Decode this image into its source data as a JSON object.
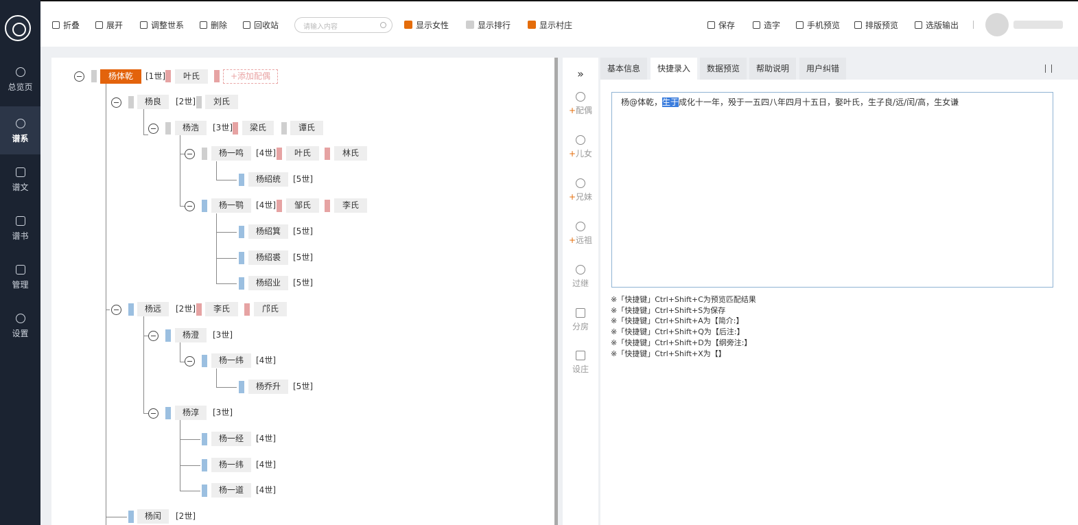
{
  "sidebar": {
    "items": [
      {
        "label": "总览页",
        "icon": "pie-chart-icon"
      },
      {
        "label": "谱系",
        "icon": "family-tree-icon"
      },
      {
        "label": "谱文",
        "icon": "document-icon"
      },
      {
        "label": "谱书",
        "icon": "book-icon"
      },
      {
        "label": "管理",
        "icon": "grid-icon"
      },
      {
        "label": "设置",
        "icon": "gear-icon"
      }
    ],
    "active": "谱系"
  },
  "toolbar": {
    "collapse": "折叠",
    "expand": "展开",
    "adjust": "调整世系",
    "delete": "删除",
    "recycle": "回收站",
    "search_placeholder": "请输入内容",
    "show_female": "显示女性",
    "show_rank": "显示排行",
    "show_village": "显示村庄",
    "save": "保存",
    "make_char": "造字",
    "mobile_preview": "手机预览",
    "layout_preview": "排版预览",
    "export": "选版输出"
  },
  "tree": {
    "root": {
      "name": "杨体乾",
      "gen": "[1世]",
      "spouse": "叶氏",
      "add_spouse": "+添加配偶"
    },
    "g2a": {
      "name": "杨良",
      "gen": "[2世]",
      "spouse": "刘氏"
    },
    "g3a": {
      "name": "杨浩",
      "gen": "[3世]",
      "spouse1": "梁氏",
      "spouse2": "谭氏"
    },
    "g4a": {
      "name": "杨一鸣",
      "gen": "[4世]",
      "spouse1": "叶氏",
      "spouse2": "林氏"
    },
    "g5a": {
      "name": "杨绍统",
      "gen": "[5世]"
    },
    "g4b": {
      "name": "杨一鹗",
      "gen": "[4世]",
      "spouse1": "邹氏",
      "spouse2": "李氏"
    },
    "g5b": {
      "name": "杨绍箕",
      "gen": "[5世]"
    },
    "g5c": {
      "name": "杨绍裘",
      "gen": "[5世]"
    },
    "g5d": {
      "name": "杨绍业",
      "gen": "[5世]"
    },
    "g2b": {
      "name": "杨远",
      "gen": "[2世]",
      "spouse1": "李氏",
      "spouse2": "邝氏"
    },
    "g3b": {
      "name": "杨澄",
      "gen": "[3世]"
    },
    "g4c": {
      "name": "杨一纬",
      "gen": "[4世]"
    },
    "g5e": {
      "name": "杨乔升",
      "gen": "[5世]"
    },
    "g3c": {
      "name": "杨淳",
      "gen": "[3世]"
    },
    "g4d": {
      "name": "杨一经",
      "gen": "[4世]"
    },
    "g4e": {
      "name": "杨一纬",
      "gen": "[4世]"
    },
    "g4f": {
      "name": "杨一道",
      "gen": "[4世]"
    },
    "g2c": {
      "name": "杨闰",
      "gen": "[2世]"
    }
  },
  "tools": {
    "expand": "»",
    "spouse": "配偶",
    "children": "儿女",
    "siblings": "兄妹",
    "ancestor": "远祖",
    "adopt": "过继",
    "branch": "分房",
    "village": "设庄",
    "plus": "+"
  },
  "tabs": [
    "基本信息",
    "快捷录入",
    "数据预览",
    "帮助说明",
    "用户纠错"
  ],
  "active_tab": "快捷录入",
  "editor": {
    "pre": "杨@体乾，",
    "selected": "生于",
    "post": "成化十一年，殁于一五四八年四月十五日，娶叶氏，生子良/远/闰/高，生女谦"
  },
  "notes": [
    "※「快捷键」Ctrl+Shift+C为预览匹配结果",
    "※「快捷键」Ctrl+Shift+S为保存",
    "※「快捷键」Ctrl+Shift+A为【简介:】",
    "※「快捷键」Ctrl+Shift+Q为【后注:】",
    "※「快捷键」Ctrl+Shift+D为【纲旁注:】",
    "※「快捷键」Ctrl+Shift+X为【】"
  ],
  "colors": {
    "accent": "#e3630c",
    "sidebar": "#1b2331",
    "male": "#9bbfe0",
    "female": "#e6a3a3"
  }
}
